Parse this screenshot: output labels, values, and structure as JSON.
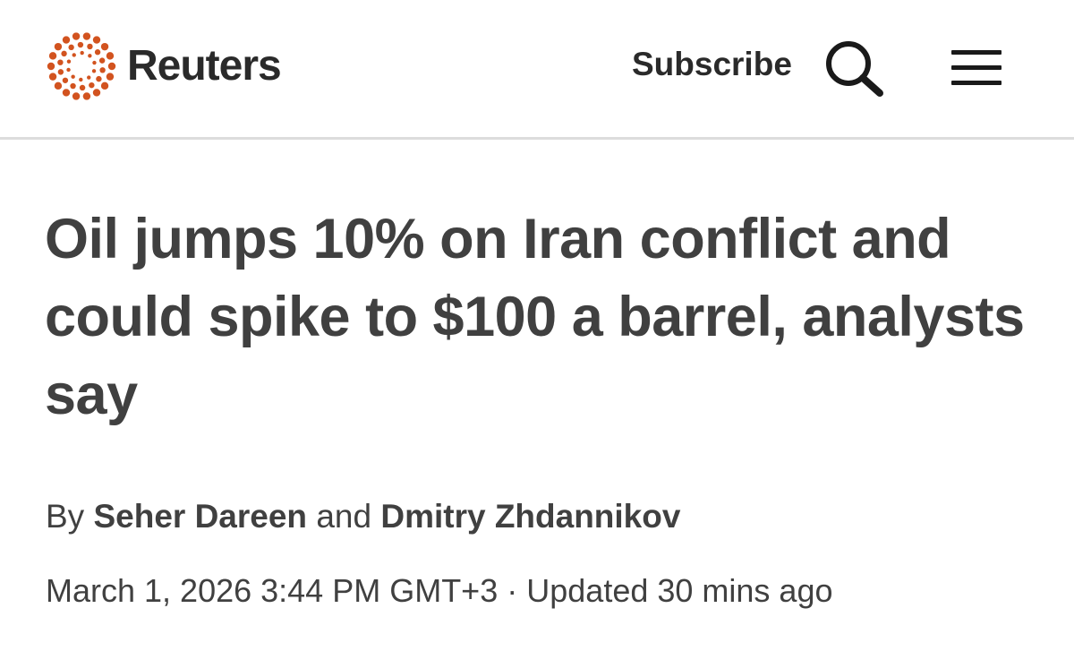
{
  "header": {
    "brand": "Reuters",
    "subscribe_label": "Subscribe",
    "search_icon": "search-icon",
    "menu_icon": "hamburger-menu-icon",
    "logo_icon": "reuters-dot-ring-logo",
    "brand_color": "#d2531f"
  },
  "article": {
    "headline": "Oil jumps 10% on Iran conflict and could spike to $100 a barrel, analysts say",
    "byline": {
      "prefix": "By",
      "author_1": "Seher Dareen",
      "conjunction": "and",
      "author_2": "Dmitry Zhdannikov"
    },
    "published": "March 1, 2026 3:44 PM GMT+3",
    "separator": "·",
    "updated": "Updated 30 mins ago"
  }
}
